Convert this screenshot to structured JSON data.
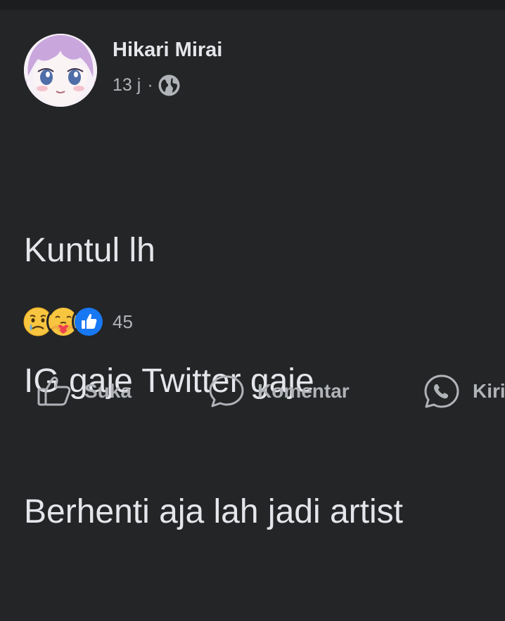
{
  "post": {
    "author": "Hikari Mirai",
    "time": "13 j",
    "separator": "·",
    "privacy_icon": "globe-icon",
    "text_lines": [
      "Kuntul lh",
      "IG gaje Twitter gaje",
      "Berhenti aja lah jadi artist"
    ],
    "reactions": {
      "icons": [
        "sad-emoji-icon",
        "care-emoji-icon",
        "like-thumb-icon"
      ],
      "count": "45"
    }
  },
  "actions": {
    "like_label": "Suka",
    "comment_label": "Komentar",
    "send_label": "Kirim"
  },
  "colors": {
    "background": "#242526",
    "primary_text": "#e4e6eb",
    "secondary_text": "#b0b3b8",
    "like_blue": "#1877f2"
  }
}
